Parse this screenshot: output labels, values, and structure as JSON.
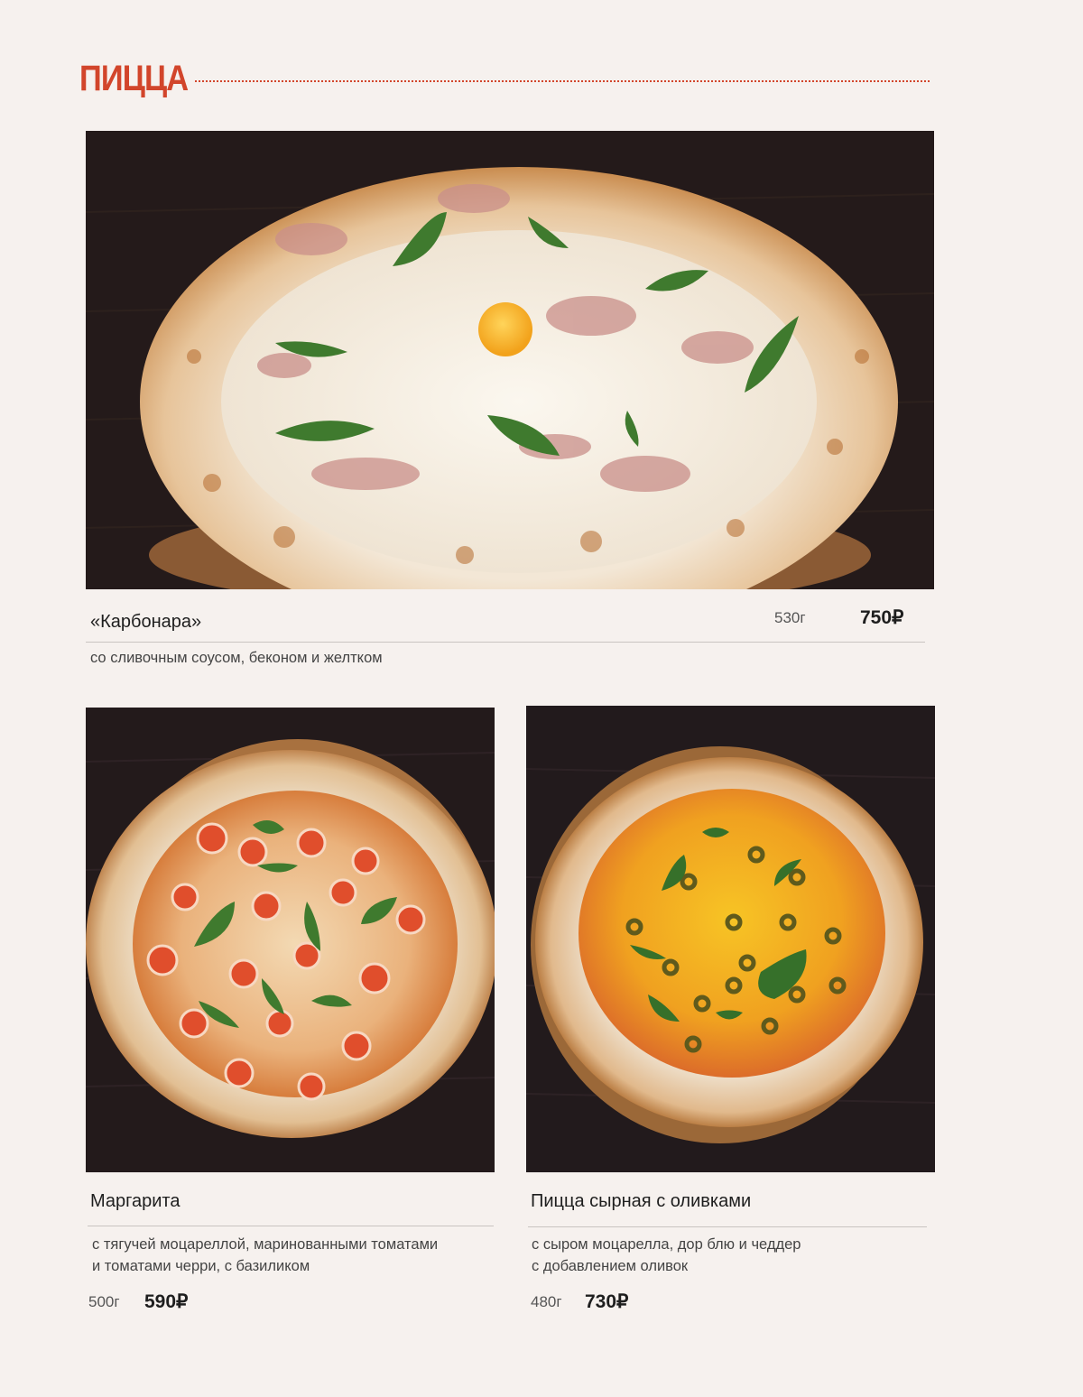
{
  "section": {
    "title": "ПИЦЦА"
  },
  "colors": {
    "accent": "#d2452b",
    "background": "#f6f1ee",
    "text": "#1e1e1e"
  },
  "items": [
    {
      "name": "«Карбонара»",
      "description": "со сливочным соусом, беконом и желтком",
      "weight": "530г",
      "price": "750₽",
      "photo": "pizza-carbonara-photo"
    },
    {
      "name": "Маргарита",
      "description_lines": [
        "с тягучей моцареллой, маринованными томатами",
        "и  томатами черри, с базиликом"
      ],
      "weight": "500г",
      "price": "590₽",
      "photo": "pizza-margarita-photo"
    },
    {
      "name": "Пицца сырная с оливками",
      "description_lines": [
        "с сыром моцарелла, дор блю и чеддер",
        "с добавлением оливок"
      ],
      "weight": "480г",
      "price": "730₽",
      "photo": "pizza-cheese-olives-photo"
    }
  ]
}
